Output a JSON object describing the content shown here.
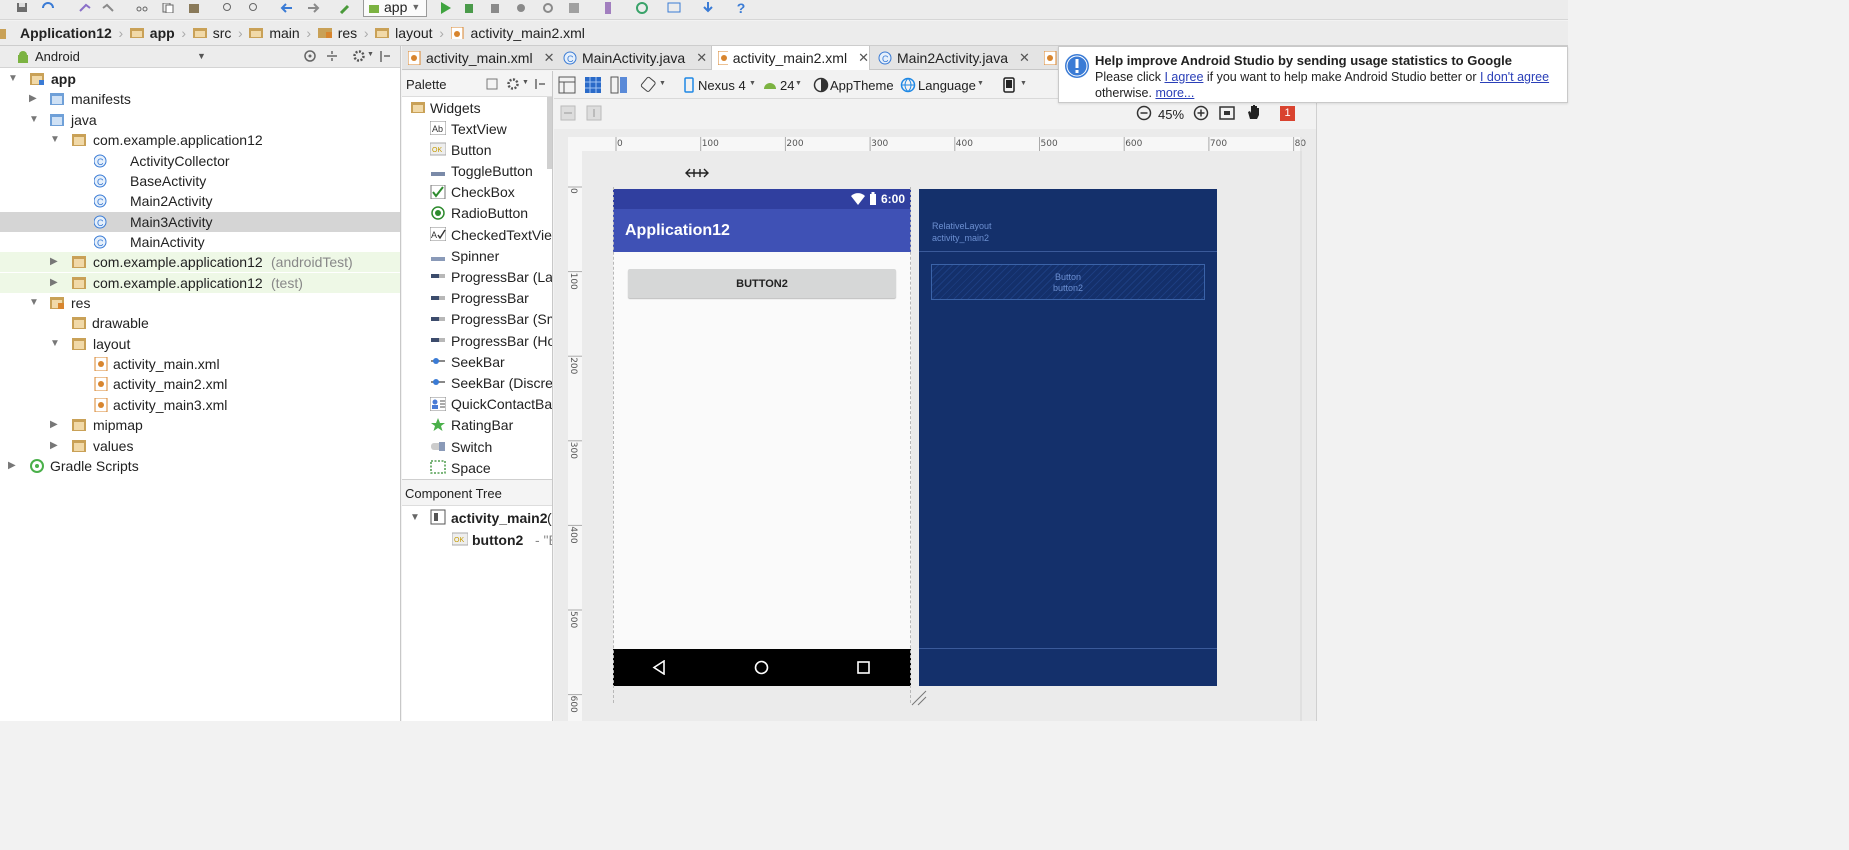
{
  "toolbar": {
    "run_config": "app"
  },
  "breadcrumb": [
    "Application12",
    "app",
    "src",
    "main",
    "res",
    "layout",
    "activity_main2.xml"
  ],
  "project": {
    "view_mode": "Android",
    "tree": [
      {
        "label": "app",
        "bold": true,
        "level": 0
      },
      {
        "label": "manifests",
        "level": 1
      },
      {
        "label": "java",
        "level": 1
      },
      {
        "label": "com.example.application12",
        "level": 2
      },
      {
        "label": "ActivityCollector",
        "level": 3
      },
      {
        "label": "BaseActivity",
        "level": 3
      },
      {
        "label": "Main2Activity",
        "level": 3
      },
      {
        "label": "Main3Activity",
        "level": 3,
        "selected": true
      },
      {
        "label": "MainActivity",
        "level": 3
      },
      {
        "label": "com.example.application12",
        "suffix": "(androidTest)",
        "level": 2
      },
      {
        "label": "com.example.application12",
        "suffix": "(test)",
        "level": 2
      },
      {
        "label": "res",
        "level": 1
      },
      {
        "label": "drawable",
        "level": 2
      },
      {
        "label": "layout",
        "level": 2
      },
      {
        "label": "activity_main.xml",
        "level": 3
      },
      {
        "label": "activity_main2.xml",
        "level": 3
      },
      {
        "label": "activity_main3.xml",
        "level": 3
      },
      {
        "label": "mipmap",
        "level": 2
      },
      {
        "label": "values",
        "level": 2
      },
      {
        "label": "Gradle Scripts",
        "level": 0
      }
    ]
  },
  "tabs": [
    {
      "label": "activity_main.xml"
    },
    {
      "label": "MainActivity.java"
    },
    {
      "label": "activity_main2.xml",
      "active": true
    },
    {
      "label": "Main2Activity.java"
    }
  ],
  "palette": {
    "title": "Palette",
    "category": "Widgets",
    "items": [
      "TextView",
      "Button",
      "ToggleButton",
      "CheckBox",
      "RadioButton",
      "CheckedTextView",
      "Spinner",
      "ProgressBar (Large)",
      "ProgressBar",
      "ProgressBar (Small)",
      "ProgressBar (Horizontal)",
      "SeekBar",
      "SeekBar (Discrete)",
      "QuickContactBadge",
      "RatingBar",
      "Switch",
      "Space"
    ]
  },
  "component_tree": {
    "title": "Component Tree",
    "root": "activity_main2",
    "root_suffix": "(",
    "child": "button2",
    "child_suffix": "- \"Bu"
  },
  "design_toolbar": {
    "device": "Nexus 4",
    "api": "24",
    "theme": "AppTheme",
    "language": "Language",
    "zoom": "45%",
    "error_count": "1"
  },
  "ruler": {
    "h_ticks": [
      "0",
      "100",
      "200",
      "300",
      "400",
      "500",
      "600",
      "700",
      "80"
    ],
    "v_ticks": [
      "0",
      "100",
      "200",
      "300",
      "400",
      "500",
      "600"
    ]
  },
  "phone": {
    "time": "6:00",
    "app_title": "Application12",
    "button_label": "BUTTON2"
  },
  "blueprint": {
    "layout_type": "RelativeLayout",
    "layout_id": "activity_main2",
    "button_type": "Button",
    "button_id": "button2"
  },
  "notification": {
    "title": "Help improve Android Studio by sending usage statistics to Google",
    "line1_pre": "Please click ",
    "agree": "I agree",
    "line1_mid": " if you want to help make Android Studio better or ",
    "disagree": "I don't agree",
    "line2_pre": "otherwise. ",
    "more": "more..."
  },
  "colors": {
    "primary": "#3f51b5",
    "status_bar": "#303f9f",
    "blueprint": "#14306b",
    "accent_green": "#4ab04a"
  }
}
